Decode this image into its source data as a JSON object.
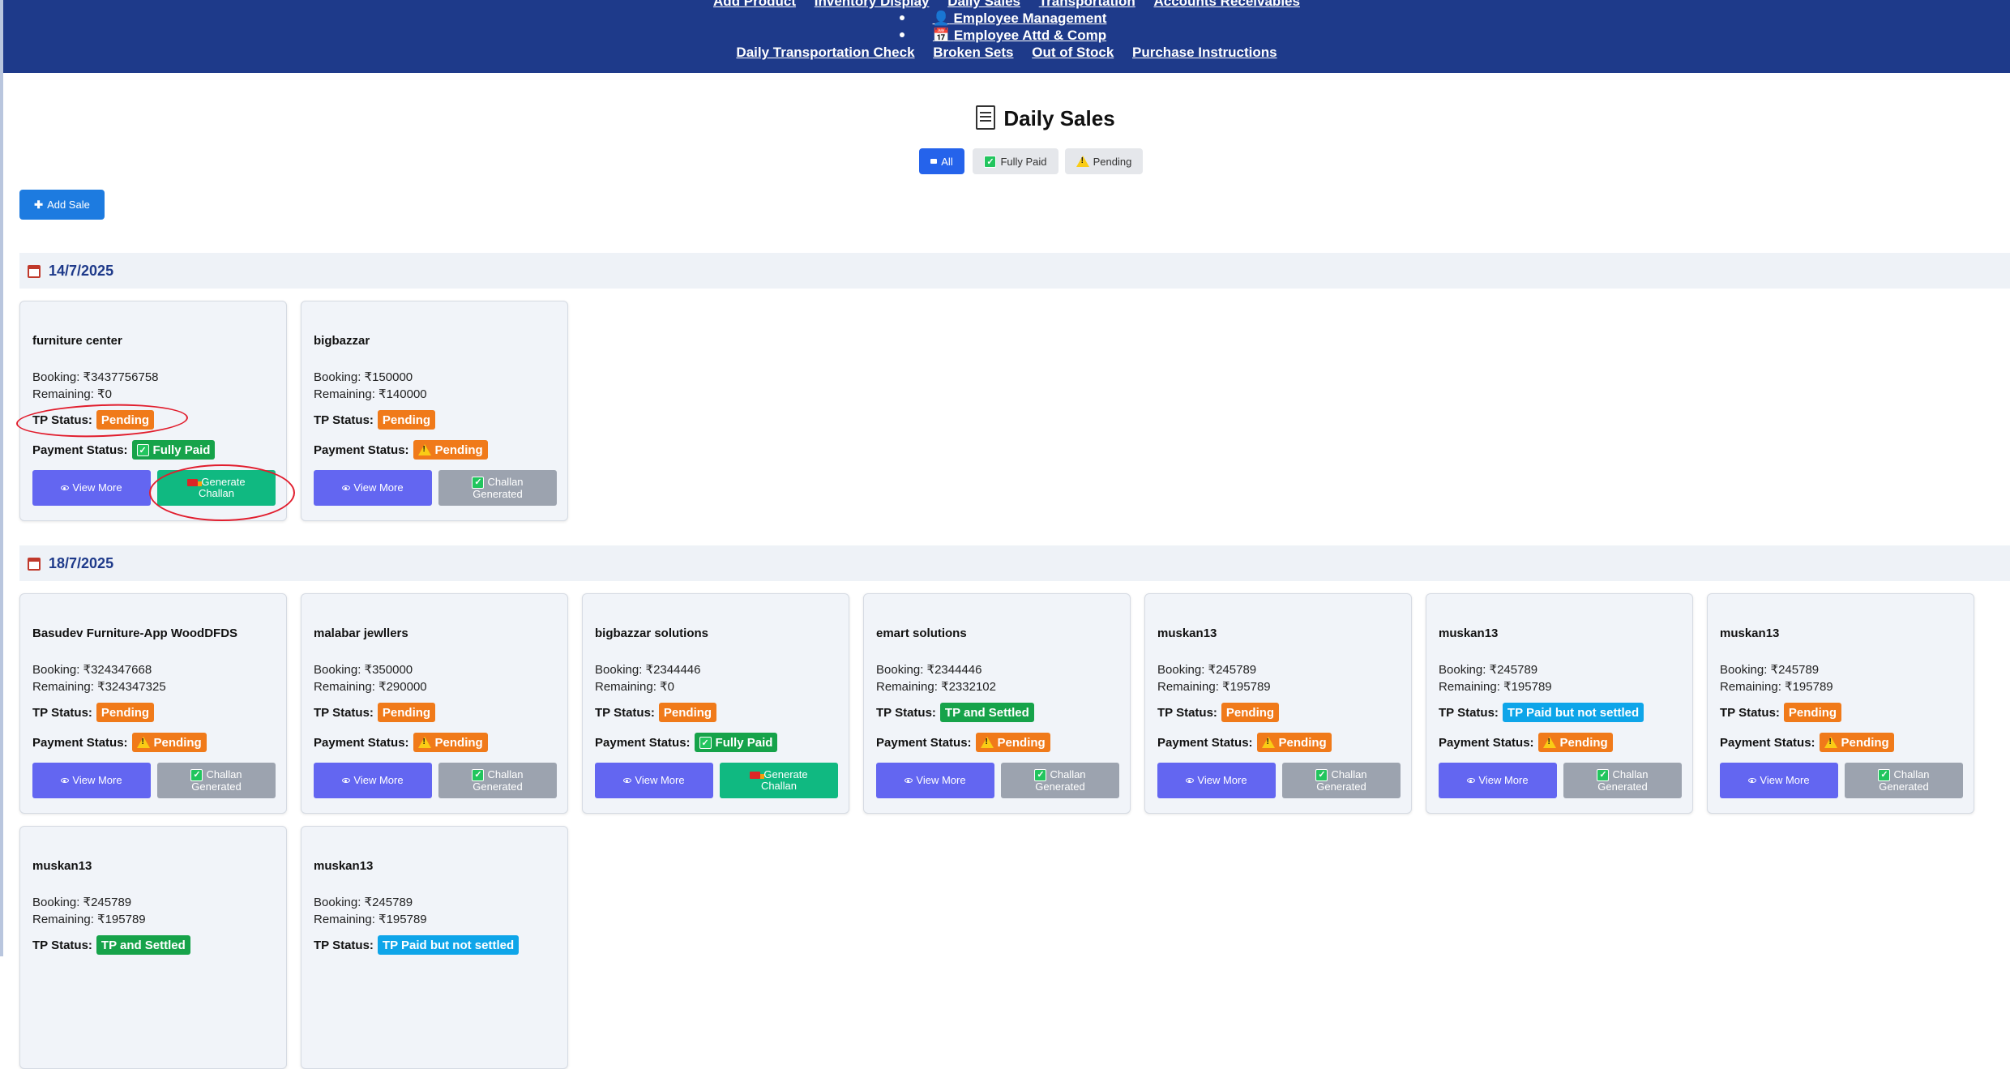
{
  "nav": {
    "row1": [
      "Add Product",
      "Inventory Display",
      "Daily Sales",
      "Transportation",
      "Accounts Receivables"
    ],
    "row2": {
      "icon": "employee-icon",
      "label": "Employee Management"
    },
    "row3": {
      "icon": "calendar-icon",
      "label": "Employee Attd & Comp"
    },
    "row4": [
      "Daily Transportation Check",
      "Broken Sets",
      "Out of Stock",
      "Purchase Instructions"
    ]
  },
  "page": {
    "title": "Daily Sales",
    "title_icon": "document-icon"
  },
  "filters": {
    "all": "All",
    "fully_paid": "Fully Paid",
    "pending": "Pending"
  },
  "add_sale": "Add Sale",
  "labels": {
    "tp_status": "TP Status:",
    "payment_status": "Payment Status:",
    "view_more": "View More",
    "generate_challan": [
      "Generate",
      "Challan"
    ],
    "challan_generated": [
      "Challan",
      "Generated"
    ]
  },
  "groups": [
    {
      "date": "14/7/2025",
      "cards": [
        {
          "name": "furniture center",
          "booking": "Booking: ₹3437756758",
          "remaining": "Remaining: ₹0",
          "tp": "Pending",
          "payment": "Fully Paid",
          "action": "generate"
        },
        {
          "name": "bigbazzar",
          "booking": "Booking: ₹150000",
          "remaining": "Remaining: ₹140000",
          "tp": "Pending",
          "payment": "Pending",
          "action": "generated"
        }
      ]
    },
    {
      "date": "18/7/2025",
      "cards": [
        {
          "name": "Basudev Furniture-App WoodDFDS",
          "booking": "Booking: ₹324347668",
          "remaining": "Remaining: ₹324347325",
          "tp": "Pending",
          "payment": "Pending",
          "action": "generated"
        },
        {
          "name": "malabar jewllers",
          "booking": "Booking: ₹350000",
          "remaining": "Remaining: ₹290000",
          "tp": "Pending",
          "payment": "Pending",
          "action": "generated"
        },
        {
          "name": "bigbazzar solutions",
          "booking": "Booking: ₹2344446",
          "remaining": "Remaining: ₹0",
          "tp": "Pending",
          "payment": "Fully Paid",
          "action": "generate"
        },
        {
          "name": "emart solutions",
          "booking": "Booking: ₹2344446",
          "remaining": "Remaining: ₹2332102",
          "tp": "TP and Settled",
          "payment": "Pending",
          "action": "generated"
        },
        {
          "name": "muskan13",
          "booking": "Booking: ₹245789",
          "remaining": "Remaining: ₹195789",
          "tp": "Pending",
          "payment": "Pending",
          "action": "generated"
        },
        {
          "name": "muskan13",
          "booking": "Booking: ₹245789",
          "remaining": "Remaining: ₹195789",
          "tp": "TP Paid but not settled",
          "payment": "Pending",
          "action": "generated"
        },
        {
          "name": "muskan13",
          "booking": "Booking: ₹245789",
          "remaining": "Remaining: ₹195789",
          "tp": "Pending",
          "payment": "Pending",
          "action": "generated"
        },
        {
          "name": "muskan13",
          "booking": "Booking: ₹245789",
          "remaining": "Remaining: ₹195789",
          "tp": "TP and Settled",
          "payment": "",
          "action": ""
        },
        {
          "name": "muskan13",
          "booking": "Booking: ₹245789",
          "remaining": "Remaining: ₹195789",
          "tp": "TP Paid but not settled",
          "payment": "",
          "action": ""
        }
      ]
    }
  ],
  "colors": {
    "nav_bg": "#1e3a8a",
    "pending": "#f07a1a",
    "fully_paid": "#16a34a",
    "tp_paid_not_settled": "#0ea5e9",
    "view_more": "#6366f1",
    "generate_challan": "#10b981",
    "challan_generated": "#9ca3af",
    "annotation": "#e11d2d"
  }
}
